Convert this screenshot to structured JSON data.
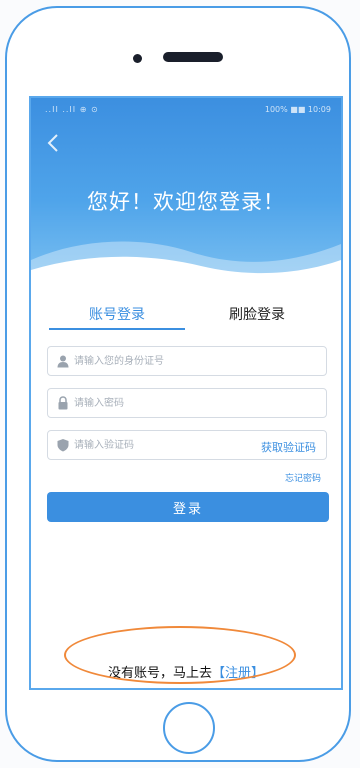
{
  "status_bar": {
    "left": "..II ..II ⊕ ⊙",
    "right": "100% ■■ 10:09"
  },
  "header": {
    "back_icon": "chevron-left-icon",
    "welcome": "您好！欢迎您登录！"
  },
  "tabs": [
    {
      "label": "账号登录",
      "active": true
    },
    {
      "label": "刷脸登录",
      "active": false
    }
  ],
  "form": {
    "id_placeholder": "请输入您的身份证号",
    "id_icon": "user-icon",
    "password_placeholder": "请输入密码",
    "password_icon": "lock-icon",
    "code_placeholder": "请输入验证码",
    "code_icon": "shield-icon",
    "get_code_label": "获取验证码",
    "forgot_label": "忘记密码",
    "login_label": "登录"
  },
  "register": {
    "prompt": "没有账号，马上去",
    "link": "【注册】"
  },
  "colors": {
    "accent": "#3b8fe0",
    "frame": "#4a9ce6",
    "highlight": "#f0893a"
  }
}
